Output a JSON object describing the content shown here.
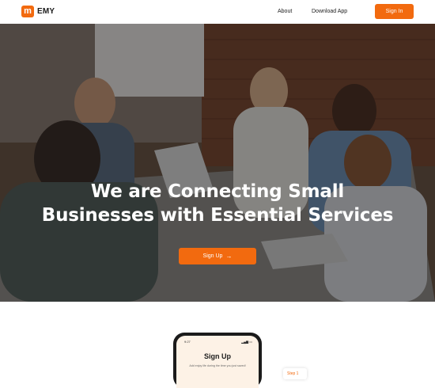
{
  "nav": {
    "logo_glyph": "m",
    "brand": "EMY",
    "links": [
      "About",
      "Download App"
    ],
    "signin_label": "Sign In"
  },
  "hero": {
    "title_line1": "We are Connecting Small",
    "title_line2": "Businesses with Essential Services",
    "cta_label": "Sign Up",
    "cta_icon": "arrow-right-icon"
  },
  "phone": {
    "status_time": "9:27",
    "title": "Sign Up",
    "subtitle": "Add enjoy life during the time you just saved!"
  },
  "step_tag": "Step 1",
  "colors": {
    "accent": "#f26a0f",
    "nav_bg": "#ffffff",
    "text_dark": "#1c1c1c"
  }
}
